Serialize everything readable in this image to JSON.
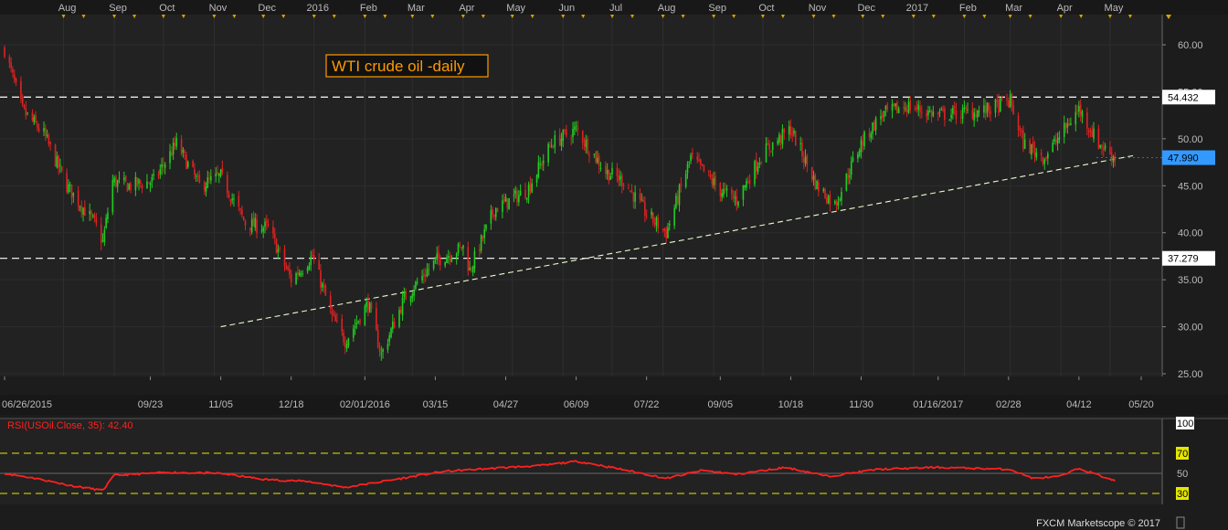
{
  "footer": "FXCM Marketscope © 2017",
  "top_months": [
    "Aug",
    "Sep",
    "Oct",
    "Nov",
    "Dec",
    "2016",
    "Feb",
    "Mar",
    "Apr",
    "May",
    "Jun",
    "Jul",
    "Aug",
    "Sep",
    "Oct",
    "Nov",
    "Dec",
    "2017",
    "Feb",
    "Mar",
    "Apr",
    "May"
  ],
  "date_labels": [
    "06/26/2015",
    "09/23",
    "11/05",
    "12/18",
    "02/01/2016",
    "03/15",
    "04/27",
    "06/09",
    "07/22",
    "09/05",
    "10/18",
    "11/30",
    "01/16/2017",
    "02/28",
    "04/12",
    "05/20"
  ],
  "colors": {
    "up": "#22cc22",
    "down": "#dd2222",
    "rsi": "#ff2020",
    "current": "#3399ff",
    "title": "#ff9900"
  },
  "chart_data": [
    {
      "type": "candlestick",
      "title": "WTI crude oil -daily",
      "ylim": [
        24,
        62
      ],
      "y_ticks": [
        "25.00",
        "30.00",
        "35.00",
        "40.00",
        "45.00",
        "50.00",
        "55.00",
        "60.00"
      ],
      "levels": [
        {
          "label": "54.432",
          "value": 54.432
        },
        {
          "label": "37.279",
          "value": 37.279
        }
      ],
      "current_price": {
        "label": "47.990",
        "value": 47.99
      },
      "trendline": {
        "from": {
          "date": "2015-11-05",
          "value": 30.0
        },
        "to": {
          "date": "2017-05-15",
          "value": 48.2
        }
      },
      "close_path": [
        {
          "date": "2015-06-26",
          "value": 59.5
        },
        {
          "date": "2015-07-07",
          "value": 53.0
        },
        {
          "date": "2015-07-20",
          "value": 50.5
        },
        {
          "date": "2015-08-03",
          "value": 45.0
        },
        {
          "date": "2015-08-20",
          "value": 41.0
        },
        {
          "date": "2015-08-25",
          "value": 39.0
        },
        {
          "date": "2015-08-31",
          "value": 45.5
        },
        {
          "date": "2015-09-10",
          "value": 45.0
        },
        {
          "date": "2015-09-25",
          "value": 45.5
        },
        {
          "date": "2015-10-09",
          "value": 49.5
        },
        {
          "date": "2015-10-23",
          "value": 45.0
        },
        {
          "date": "2015-11-05",
          "value": 46.0
        },
        {
          "date": "2015-11-20",
          "value": 41.0
        },
        {
          "date": "2015-12-04",
          "value": 40.5
        },
        {
          "date": "2015-12-18",
          "value": 35.0
        },
        {
          "date": "2015-12-31",
          "value": 37.5
        },
        {
          "date": "2016-01-12",
          "value": 31.0
        },
        {
          "date": "2016-01-20",
          "value": 28.5
        },
        {
          "date": "2016-02-03",
          "value": 32.5
        },
        {
          "date": "2016-02-11",
          "value": 27.0
        },
        {
          "date": "2016-02-25",
          "value": 33.0
        },
        {
          "date": "2016-03-15",
          "value": 37.0
        },
        {
          "date": "2016-04-01",
          "value": 38.5
        },
        {
          "date": "2016-04-05",
          "value": 36.0
        },
        {
          "date": "2016-04-20",
          "value": 42.5
        },
        {
          "date": "2016-05-10",
          "value": 44.5
        },
        {
          "date": "2016-05-25",
          "value": 49.5
        },
        {
          "date": "2016-06-09",
          "value": 51.0
        },
        {
          "date": "2016-06-27",
          "value": 46.5
        },
        {
          "date": "2016-07-08",
          "value": 45.5
        },
        {
          "date": "2016-07-22",
          "value": 42.0
        },
        {
          "date": "2016-08-03",
          "value": 40.0
        },
        {
          "date": "2016-08-18",
          "value": 48.0
        },
        {
          "date": "2016-09-05",
          "value": 44.5
        },
        {
          "date": "2016-09-15",
          "value": 43.5
        },
        {
          "date": "2016-10-01",
          "value": 48.5
        },
        {
          "date": "2016-10-18",
          "value": 51.0
        },
        {
          "date": "2016-11-03",
          "value": 45.0
        },
        {
          "date": "2016-11-14",
          "value": 43.0
        },
        {
          "date": "2016-11-30",
          "value": 49.5
        },
        {
          "date": "2016-12-12",
          "value": 52.5
        },
        {
          "date": "2016-12-28",
          "value": 53.5
        },
        {
          "date": "2017-01-16",
          "value": 52.5
        },
        {
          "date": "2017-02-14",
          "value": 53.0
        },
        {
          "date": "2017-03-01",
          "value": 54.0
        },
        {
          "date": "2017-03-09",
          "value": 49.5
        },
        {
          "date": "2017-03-22",
          "value": 48.0
        },
        {
          "date": "2017-04-12",
          "value": 53.2
        },
        {
          "date": "2017-04-24",
          "value": 49.5
        },
        {
          "date": "2017-05-04",
          "value": 48.0
        }
      ]
    },
    {
      "type": "line",
      "title": "RSI(USOil.Close, 35): 42.40",
      "ylim": [
        20,
        100
      ],
      "y_ticks": [
        "100",
        "70",
        "50",
        "30"
      ],
      "levels": [
        70,
        30
      ],
      "series": [
        {
          "values_path": [
            {
              "date": "2015-06-26",
              "value": 50
            },
            {
              "date": "2015-07-15",
              "value": 45
            },
            {
              "date": "2015-08-05",
              "value": 38
            },
            {
              "date": "2015-08-25",
              "value": 33
            },
            {
              "date": "2015-09-01",
              "value": 48
            },
            {
              "date": "2015-10-05",
              "value": 51
            },
            {
              "date": "2015-11-05",
              "value": 50
            },
            {
              "date": "2015-12-01",
              "value": 44
            },
            {
              "date": "2015-12-28",
              "value": 42
            },
            {
              "date": "2016-01-20",
              "value": 36
            },
            {
              "date": "2016-02-20",
              "value": 44
            },
            {
              "date": "2016-03-20",
              "value": 52
            },
            {
              "date": "2016-04-20",
              "value": 55
            },
            {
              "date": "2016-05-20",
              "value": 58
            },
            {
              "date": "2016-06-10",
              "value": 62
            },
            {
              "date": "2016-07-10",
              "value": 53
            },
            {
              "date": "2016-08-03",
              "value": 45
            },
            {
              "date": "2016-08-25",
              "value": 53
            },
            {
              "date": "2016-09-15",
              "value": 49
            },
            {
              "date": "2016-10-15",
              "value": 56
            },
            {
              "date": "2016-11-10",
              "value": 47
            },
            {
              "date": "2016-12-10",
              "value": 54
            },
            {
              "date": "2017-01-16",
              "value": 56
            },
            {
              "date": "2017-03-01",
              "value": 54
            },
            {
              "date": "2017-03-15",
              "value": 45
            },
            {
              "date": "2017-04-01",
              "value": 47
            },
            {
              "date": "2017-04-12",
              "value": 55
            },
            {
              "date": "2017-05-04",
              "value": 42.4
            }
          ]
        }
      ]
    }
  ]
}
